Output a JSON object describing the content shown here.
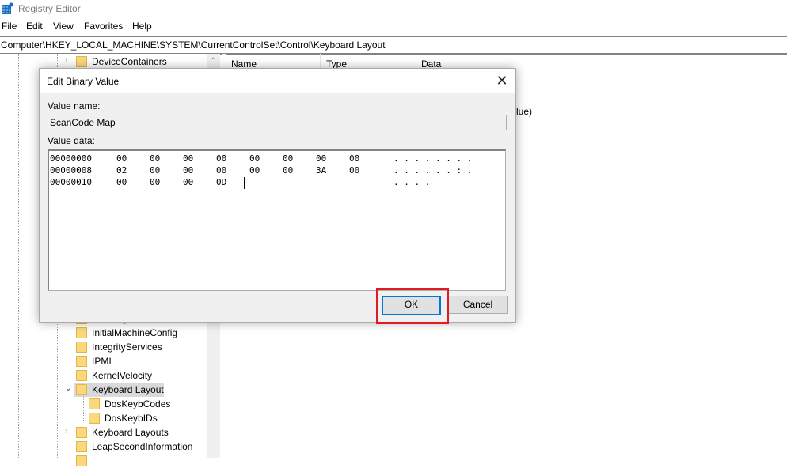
{
  "window": {
    "title": "Registry Editor",
    "icon": "regedit-icon"
  },
  "menu": [
    "File",
    "Edit",
    "View",
    "Favorites",
    "Help"
  ],
  "address": "Computer\\HKEY_LOCAL_MACHINE\\SYSTEM\\CurrentControlSet\\Control\\Keyboard Layout",
  "tree": {
    "items": [
      {
        "label": "DeviceContainers",
        "expander": "collapsed"
      },
      {
        "label": "IoConfig",
        "expander": "collapsed",
        "partially_hidden": true
      },
      {
        "label": "InitialMachineConfig",
        "expander": "none"
      },
      {
        "label": "IntegrityServices",
        "expander": "none"
      },
      {
        "label": "IPMI",
        "expander": "none"
      },
      {
        "label": "KernelVelocity",
        "expander": "none"
      },
      {
        "label": "Keyboard Layout",
        "expander": "expanded",
        "selected": true
      },
      {
        "label": "DosKeybCodes",
        "expander": "none",
        "child": true
      },
      {
        "label": "DosKeybIDs",
        "expander": "none",
        "child": true
      },
      {
        "label": "Keyboard Layouts",
        "expander": "collapsed"
      },
      {
        "label": "LeapSecondInformation",
        "expander": "none"
      }
    ]
  },
  "list": {
    "columns": [
      "Name",
      "Type",
      "Data"
    ],
    "visible_fragment": "lue)"
  },
  "dialog": {
    "title": "Edit Binary Value",
    "value_name_label": "Value name:",
    "value_name": "ScanCode Map",
    "value_data_label": "Value data:",
    "rows": [
      {
        "offset": "00000000",
        "bytes": [
          "00",
          "00",
          "00",
          "00",
          "00",
          "00",
          "00",
          "00"
        ],
        "ascii": ". . . . . . . ."
      },
      {
        "offset": "00000008",
        "bytes": [
          "02",
          "00",
          "00",
          "00",
          "00",
          "00",
          "3A",
          "00"
        ],
        "ascii": ". . . . . . : ."
      },
      {
        "offset": "00000010",
        "bytes": [
          "00",
          "00",
          "00",
          "0D"
        ],
        "ascii": ". . . ."
      }
    ],
    "ok_label": "OK",
    "cancel_label": "Cancel"
  },
  "annotation": {
    "highlight_target": "OK",
    "color": "#e01b24"
  }
}
